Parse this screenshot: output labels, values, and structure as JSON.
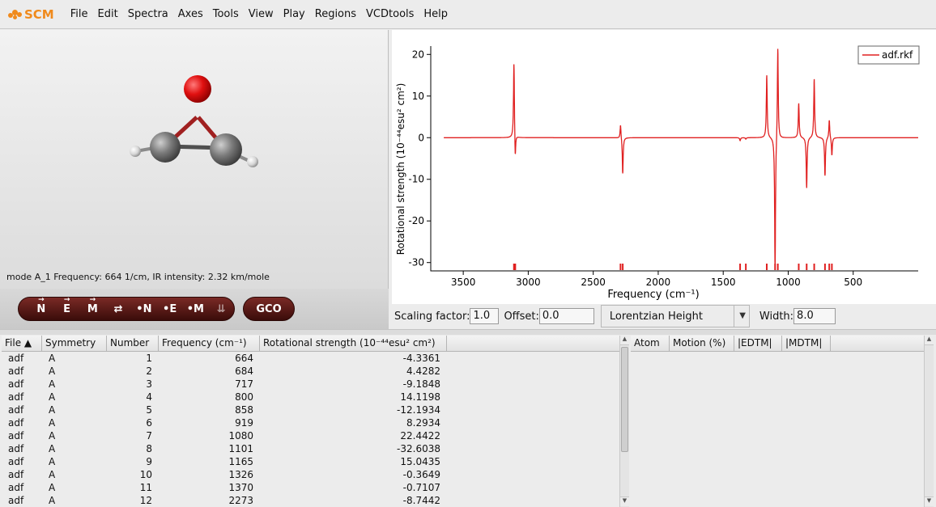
{
  "app": {
    "logo_text": "SCM",
    "menu": [
      "File",
      "Edit",
      "Spectra",
      "Axes",
      "Tools",
      "View",
      "Play",
      "Regions",
      "VCDtools",
      "Help"
    ]
  },
  "molecule": {
    "mode_info": "mode A_1 Frequency:  664 1/cm, IR intensity:   2.32 km/mole"
  },
  "vector_toolbar": {
    "buttons": [
      "N",
      "E",
      "M",
      "⇄",
      "•N",
      "•E",
      "•M",
      "⇊"
    ],
    "gco_label": "GCO"
  },
  "chart_data": {
    "type": "line",
    "xlabel": "Frequency (cm⁻¹)",
    "ylabel": "Rotational strength (10⁻⁴⁴esu² cm²)",
    "xlim": [
      3750,
      0
    ],
    "ylim": [
      -32,
      22
    ],
    "x_ticks": [
      3500,
      3000,
      2500,
      2000,
      1500,
      1000,
      500
    ],
    "y_ticks": [
      20,
      10,
      0,
      -10,
      -20,
      -30
    ],
    "legend": {
      "label": "adf.rkf",
      "position": "top-right"
    },
    "series": [
      {
        "name": "adf.rkf",
        "color": "#e02020",
        "lineshape": "Lorentzian",
        "width": 8.0,
        "peaks": [
          {
            "x": 664,
            "y": -4.3361
          },
          {
            "x": 684,
            "y": 4.4282
          },
          {
            "x": 717,
            "y": -9.1848
          },
          {
            "x": 800,
            "y": 14.1198
          },
          {
            "x": 858,
            "y": -12.1934
          },
          {
            "x": 919,
            "y": 8.2934
          },
          {
            "x": 1080,
            "y": 22.4422
          },
          {
            "x": 1101,
            "y": -32.6038
          },
          {
            "x": 1165,
            "y": 15.0435
          },
          {
            "x": 1326,
            "y": -0.3649
          },
          {
            "x": 1370,
            "y": -0.7107
          },
          {
            "x": 2273,
            "y": -8.7442
          },
          {
            "x": 2290,
            "y": 3.4
          },
          {
            "x": 3100,
            "y": -6.3
          },
          {
            "x": 3110,
            "y": 18.5
          }
        ]
      }
    ]
  },
  "settings": {
    "scaling_label": "Scaling factor:",
    "scaling_value": "1.0",
    "offset_label": "Offset:",
    "offset_value": "0.0",
    "lineshape_value": "Lorentzian Height",
    "width_label": "Width:",
    "width_value": "8.0"
  },
  "modes_table": {
    "columns": [
      "File",
      "Symmetry",
      "Number",
      "Frequency (cm⁻¹)",
      "Rotational strength (10⁻⁴⁴esu² cm²)"
    ],
    "rows": [
      [
        "adf",
        "A",
        "1",
        "664",
        "-4.3361"
      ],
      [
        "adf",
        "A",
        "2",
        "684",
        "4.4282"
      ],
      [
        "adf",
        "A",
        "3",
        "717",
        "-9.1848"
      ],
      [
        "adf",
        "A",
        "4",
        "800",
        "14.1198"
      ],
      [
        "adf",
        "A",
        "5",
        "858",
        "-12.1934"
      ],
      [
        "adf",
        "A",
        "6",
        "919",
        "8.2934"
      ],
      [
        "adf",
        "A",
        "7",
        "1080",
        "22.4422"
      ],
      [
        "adf",
        "A",
        "8",
        "1101",
        "-32.6038"
      ],
      [
        "adf",
        "A",
        "9",
        "1165",
        "15.0435"
      ],
      [
        "adf",
        "A",
        "10",
        "1326",
        "-0.3649"
      ],
      [
        "adf",
        "A",
        "11",
        "1370",
        "-0.7107"
      ],
      [
        "adf",
        "A",
        "12",
        "2273",
        "-8.7442"
      ]
    ]
  },
  "atoms_table": {
    "columns": [
      "Atom",
      "Motion (%)",
      "|EDTM|",
      "|MDTM|"
    ]
  }
}
